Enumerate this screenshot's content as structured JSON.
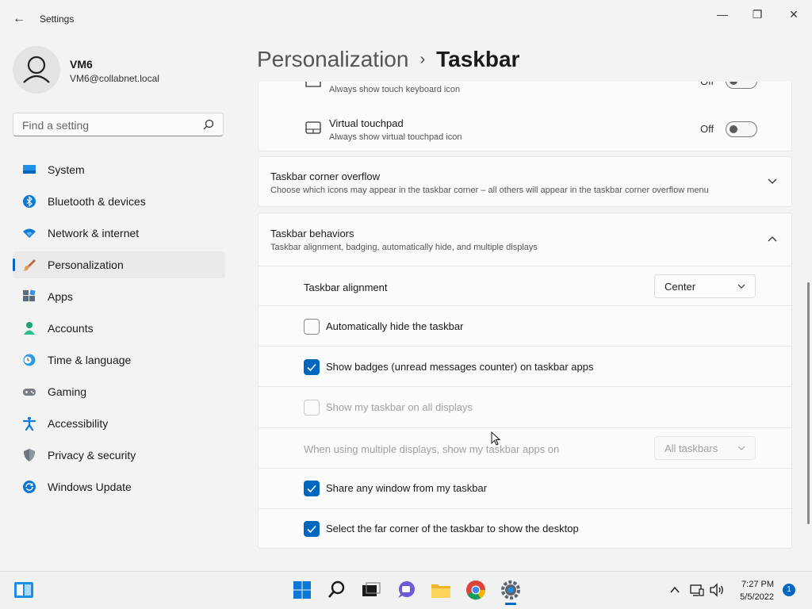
{
  "window": {
    "title": "Settings",
    "back_glyph": "←",
    "minimize_glyph": "—",
    "maximize_glyph": "❐",
    "close_glyph": "✕"
  },
  "user": {
    "name": "VM6",
    "email": "VM6@collabnet.local"
  },
  "search": {
    "placeholder": "Find a setting"
  },
  "sidebar": {
    "items": [
      {
        "label": "System",
        "icon": "system-icon"
      },
      {
        "label": "Bluetooth & devices",
        "icon": "bluetooth-icon"
      },
      {
        "label": "Network & internet",
        "icon": "network-icon"
      },
      {
        "label": "Personalization",
        "icon": "personalization-icon",
        "selected": true
      },
      {
        "label": "Apps",
        "icon": "apps-icon"
      },
      {
        "label": "Accounts",
        "icon": "accounts-icon"
      },
      {
        "label": "Time & language",
        "icon": "time-language-icon"
      },
      {
        "label": "Gaming",
        "icon": "gaming-icon"
      },
      {
        "label": "Accessibility",
        "icon": "accessibility-icon"
      },
      {
        "label": "Privacy & security",
        "icon": "privacy-icon"
      },
      {
        "label": "Windows Update",
        "icon": "windows-update-icon"
      }
    ]
  },
  "breadcrumb": {
    "parent": "Personalization",
    "separator": "›",
    "current": "Taskbar"
  },
  "corner_icons": {
    "touch_keyboard": {
      "subtitle": "Always show touch keyboard icon",
      "state": "Off"
    },
    "virtual_touchpad": {
      "title": "Virtual touchpad",
      "subtitle": "Always show virtual touchpad icon",
      "state": "Off"
    }
  },
  "corner_overflow": {
    "title": "Taskbar corner overflow",
    "subtitle": "Choose which icons may appear in the taskbar corner – all others will appear in the taskbar corner overflow menu"
  },
  "behaviors": {
    "title": "Taskbar behaviors",
    "subtitle": "Taskbar alignment, badging, automatically hide, and multiple displays",
    "alignment_label": "Taskbar alignment",
    "alignment_value": "Center",
    "auto_hide": {
      "label": "Automatically hide the taskbar",
      "checked": false
    },
    "badges": {
      "label": "Show badges (unread messages counter) on taskbar apps",
      "checked": true
    },
    "all_displays": {
      "label": "Show my taskbar on all displays",
      "checked": false,
      "disabled": true
    },
    "multi_display_label": "When using multiple displays, show my taskbar apps on",
    "multi_display_value": "All taskbars",
    "share_window": {
      "label": "Share any window from my taskbar",
      "checked": true
    },
    "far_corner": {
      "label": "Select the far corner of the taskbar to show the desktop",
      "checked": true
    }
  },
  "taskbar": {
    "time": "7:27 PM",
    "date": "5/5/2022",
    "notification_count": "1",
    "accent_color": "#0067c0"
  }
}
